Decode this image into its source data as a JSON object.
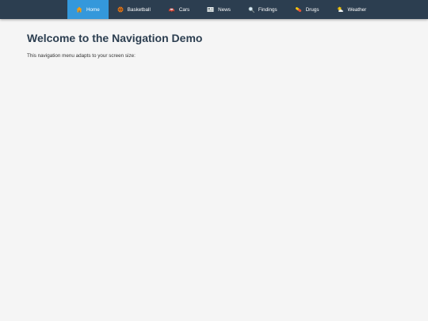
{
  "nav": {
    "items": [
      {
        "label": "Home",
        "icon": "home-icon",
        "active": true
      },
      {
        "label": "Basketball",
        "icon": "basketball-icon",
        "active": false
      },
      {
        "label": "Cars",
        "icon": "car-icon",
        "active": false
      },
      {
        "label": "News",
        "icon": "newspaper-icon",
        "active": false
      },
      {
        "label": "Findings",
        "icon": "magnifier-icon",
        "active": false
      },
      {
        "label": "Drugs",
        "icon": "pill-icon",
        "active": false
      },
      {
        "label": "Weather",
        "icon": "sun-cloud-icon",
        "active": false
      }
    ]
  },
  "main": {
    "title": "Welcome to the Navigation Demo",
    "description": "This navigation menu adapts to your screen size:"
  },
  "colors": {
    "nav_bg": "#2c3e50",
    "active_bg": "#3498db",
    "page_bg": "#f5f5f5",
    "title": "#2c3e50"
  }
}
